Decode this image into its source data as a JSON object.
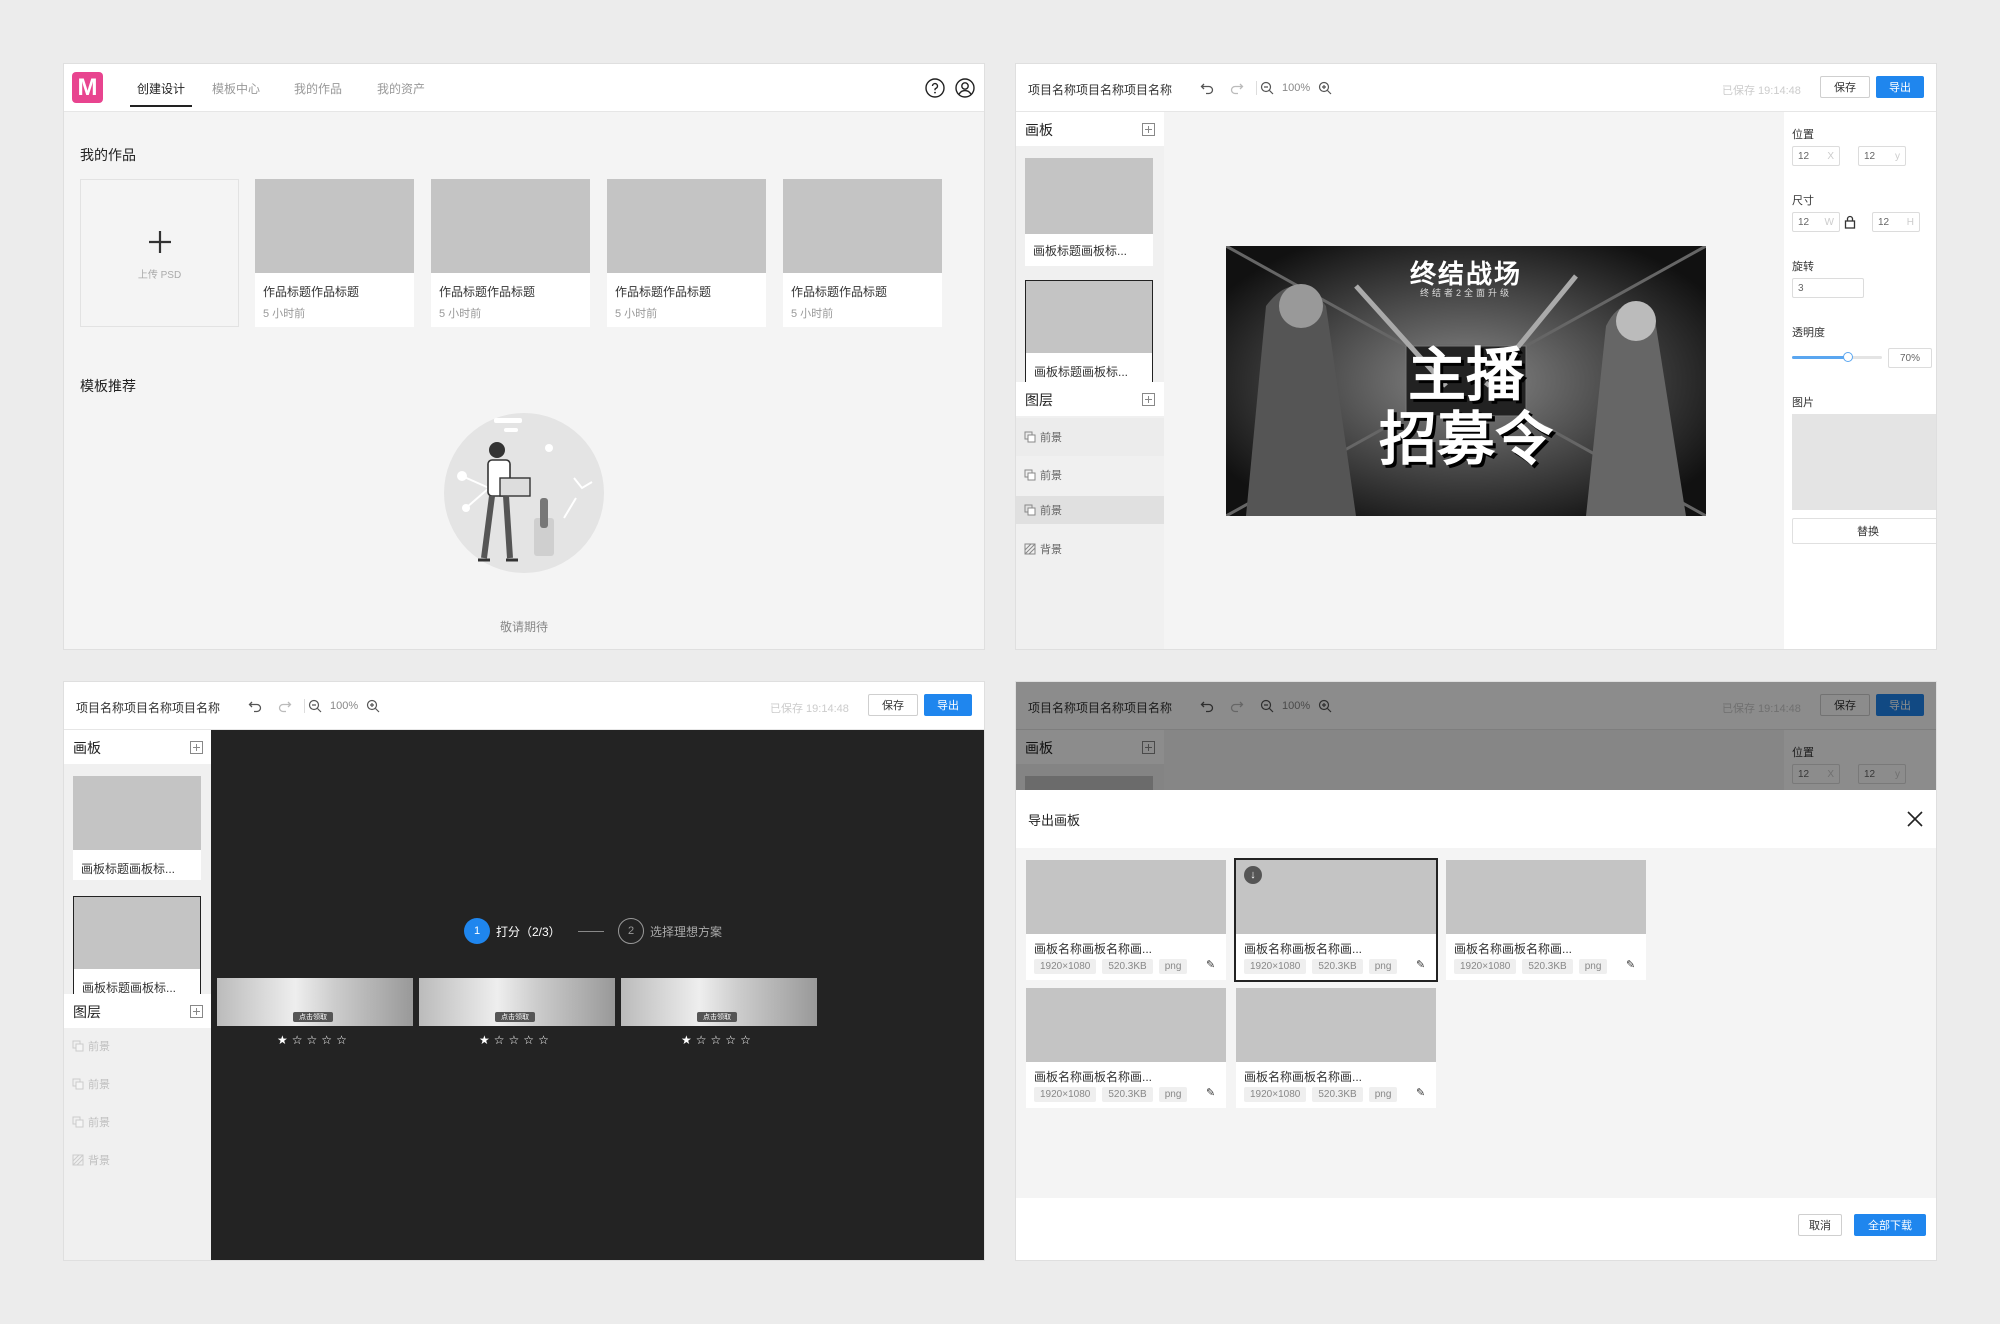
{
  "home": {
    "logo_letter": "M",
    "nav": [
      "创建设计",
      "模板中心",
      "我的作品",
      "我的资产"
    ],
    "my_works_title": "我的作品",
    "upload_label": "上传 PSD",
    "works": [
      {
        "title": "作品标题作品标题",
        "time": "5 小时前"
      },
      {
        "title": "作品标题作品标题",
        "time": "5 小时前"
      },
      {
        "title": "作品标题作品标题",
        "time": "5 小时前"
      },
      {
        "title": "作品标题作品标题",
        "time": "5 小时前"
      }
    ],
    "template_title": "模板推荐",
    "empty_text": "敬请期待"
  },
  "editor": {
    "project_name": "项目名称项目名称项目名称",
    "zoom": "100%",
    "saved_text": "已保存 19:14:48",
    "save_label": "保存",
    "export_label": "导出",
    "boards_title": "画板",
    "board_items": [
      "画板标题画板标...",
      "画板标题画板标..."
    ],
    "layers_title": "图层",
    "layers": [
      "前景",
      "前景",
      "前景",
      "背景"
    ],
    "canvas": {
      "title": "终结战场",
      "subtitle": "终结者2全面升级",
      "headline1": "主播",
      "headline2": "招募令"
    },
    "props": {
      "position_label": "位置",
      "x": "12",
      "x_unit": "X",
      "y": "12",
      "y_unit": "y",
      "size_label": "尺寸",
      "w": "12",
      "w_unit": "W",
      "h": "12",
      "h_unit": "H",
      "rotate_label": "旋转",
      "rotate": "3",
      "opacity_label": "透明度",
      "opacity": "70%",
      "opacity_value": 0.62,
      "image_label": "图片",
      "replace_label": "替换"
    }
  },
  "scoring": {
    "step1_num": "1",
    "step1_label": "打分（2/3）",
    "step2_num": "2",
    "step2_label": "选择理想方案",
    "banner_text": "点击领取",
    "candidates": [
      {
        "rating": 1,
        "max": 5
      },
      {
        "rating": 1,
        "max": 5
      },
      {
        "rating": 1,
        "max": 5
      }
    ]
  },
  "export": {
    "dialog_title": "导出画板",
    "items": [
      {
        "name": "画板名称画板名称画...",
        "size": "1920×1080",
        "filesize": "520.3KB",
        "format": "png",
        "selected": false
      },
      {
        "name": "画板名称画板名称画...",
        "size": "1920×1080",
        "filesize": "520.3KB",
        "format": "png",
        "selected": true
      },
      {
        "name": "画板名称画板名称画...",
        "size": "1920×1080",
        "filesize": "520.3KB",
        "format": "png",
        "selected": false
      },
      {
        "name": "画板名称画板名称画...",
        "size": "1920×1080",
        "filesize": "520.3KB",
        "format": "png",
        "selected": false
      },
      {
        "name": "画板名称画板名称画...",
        "size": "1920×1080",
        "filesize": "520.3KB",
        "format": "png",
        "selected": false
      }
    ],
    "cancel_label": "取消",
    "download_all_label": "全部下载"
  }
}
